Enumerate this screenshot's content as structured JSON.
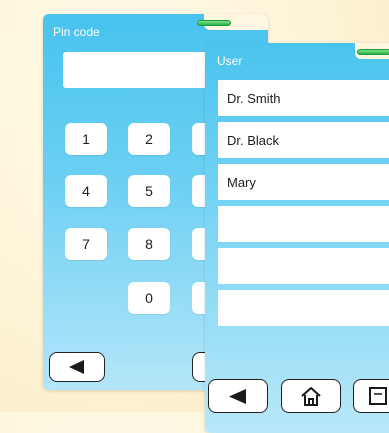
{
  "pin_screen": {
    "title": "Pin code",
    "display_value": "",
    "keys": [
      "1",
      "2",
      "4",
      "5",
      "7",
      "8",
      "0"
    ],
    "back_button_icon": "back-arrow-icon"
  },
  "user_screen": {
    "title": "User",
    "users": [
      "Dr. Smith",
      "Dr. Black",
      "Mary",
      "",
      "",
      ""
    ],
    "toolbar_icons": [
      "back-arrow-icon",
      "home-icon",
      "document-icon"
    ]
  },
  "colors": {
    "panel_blue": "#47c3ee",
    "panel_light": "#b4e6f9",
    "tab_handle": "#2bb54a",
    "background": "#fdf3d6"
  }
}
